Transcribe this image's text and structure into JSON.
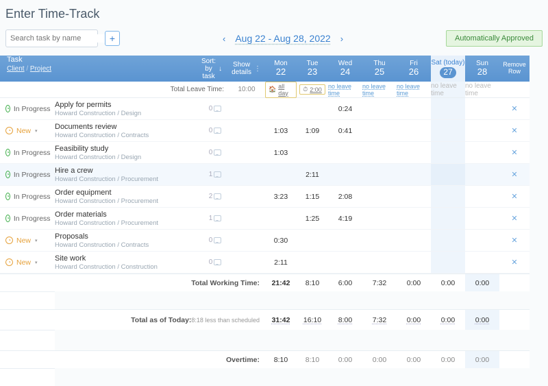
{
  "title": "Enter Time-Track",
  "search": {
    "placeholder": "Search task by name"
  },
  "date_range": {
    "label": "Aug 22 - Aug 28, 2022"
  },
  "approval": {
    "label": "Automatically Approved"
  },
  "header": {
    "task": "Task",
    "client_project": "Client / Project",
    "sort": "Sort: by task",
    "show_details": "Show details",
    "remove": "Remove Row",
    "days": [
      {
        "dow": "Mon",
        "num": "22",
        "today": false
      },
      {
        "dow": "Tue",
        "num": "23",
        "today": false
      },
      {
        "dow": "Wed",
        "num": "24",
        "today": false
      },
      {
        "dow": "Thu",
        "num": "25",
        "today": false
      },
      {
        "dow": "Fri",
        "num": "26",
        "today": false
      },
      {
        "dow": "Sat (today)",
        "num": "27",
        "today": true
      },
      {
        "dow": "Sun",
        "num": "28",
        "today": false
      }
    ]
  },
  "leave": {
    "label": "Total Leave Time:",
    "total": "10:00",
    "cells": [
      {
        "type": "tag",
        "icon": "home",
        "text": "all day"
      },
      {
        "type": "tag",
        "icon": "clock",
        "text": "2:00"
      },
      {
        "type": "link",
        "text": "no leave time"
      },
      {
        "type": "link",
        "text": "no leave time"
      },
      {
        "type": "link",
        "text": "no leave time"
      },
      {
        "type": "text",
        "text": "no leave time",
        "today": true
      },
      {
        "type": "text",
        "text": "no leave time"
      }
    ]
  },
  "rows": [
    {
      "status": "In Progress",
      "statusClass": "ip",
      "task": "Apply for permits",
      "proj": "Howard Construction / Design",
      "comments": 0,
      "vals": [
        "",
        "",
        "0:24",
        "",
        "",
        "",
        ""
      ],
      "hl": false
    },
    {
      "status": "New",
      "statusClass": "nw",
      "task": "Documents review",
      "proj": "Howard Construction / Contracts",
      "comments": 0,
      "vals": [
        "1:03",
        "1:09",
        "0:41",
        "",
        "",
        "",
        ""
      ],
      "hl": false
    },
    {
      "status": "In Progress",
      "statusClass": "ip",
      "task": "Feasibility study",
      "proj": "Howard Construction / Design",
      "comments": 0,
      "vals": [
        "1:03",
        "",
        "",
        "",
        "",
        "",
        ""
      ],
      "hl": false
    },
    {
      "status": "In Progress",
      "statusClass": "ip",
      "task": "Hire a crew",
      "proj": "Howard Construction / Procurement",
      "comments": 1,
      "vals": [
        "",
        "2:11",
        "",
        "",
        "",
        "",
        ""
      ],
      "hl": true
    },
    {
      "status": "In Progress",
      "statusClass": "ip",
      "task": "Order equipment",
      "proj": "Howard Construction / Procurement",
      "comments": 2,
      "vals": [
        "3:23",
        "1:15",
        "2:08",
        "",
        "",
        "",
        ""
      ],
      "hl": false
    },
    {
      "status": "In Progress",
      "statusClass": "ip",
      "task": "Order materials",
      "proj": "Howard Construction / Procurement",
      "comments": 1,
      "vals": [
        "",
        "1:25",
        "4:19",
        "",
        "",
        "",
        ""
      ],
      "hl": false
    },
    {
      "status": "New",
      "statusClass": "nw",
      "task": "Proposals",
      "proj": "Howard Construction / Contracts",
      "comments": 0,
      "vals": [
        "0:30",
        "",
        "",
        "",
        "",
        "",
        ""
      ],
      "hl": false
    },
    {
      "status": "New",
      "statusClass": "nw",
      "task": "Site work",
      "proj": "Howard Construction / Construction",
      "comments": 0,
      "vals": [
        "2:11",
        "",
        "",
        "",
        "",
        "",
        ""
      ],
      "hl": false
    }
  ],
  "summary": {
    "working": {
      "label": "Total Working Time:",
      "total": "21:42",
      "vals": [
        "8:10",
        "6:00",
        "7:32",
        "0:00",
        "0:00",
        "0:00",
        ""
      ]
    },
    "today": {
      "label": "Total as of Today:",
      "sub": "8:18 less than scheduled",
      "total": "31:42",
      "vals": [
        "16:10",
        "8:00",
        "7:32",
        "0:00",
        "0:00",
        "0:00",
        ""
      ]
    },
    "overtime": {
      "label": "Overtime:",
      "total": "8:10",
      "vals": [
        "8:10",
        "0:00",
        "0:00",
        "0:00",
        "0:00",
        "0:00",
        ""
      ]
    }
  }
}
